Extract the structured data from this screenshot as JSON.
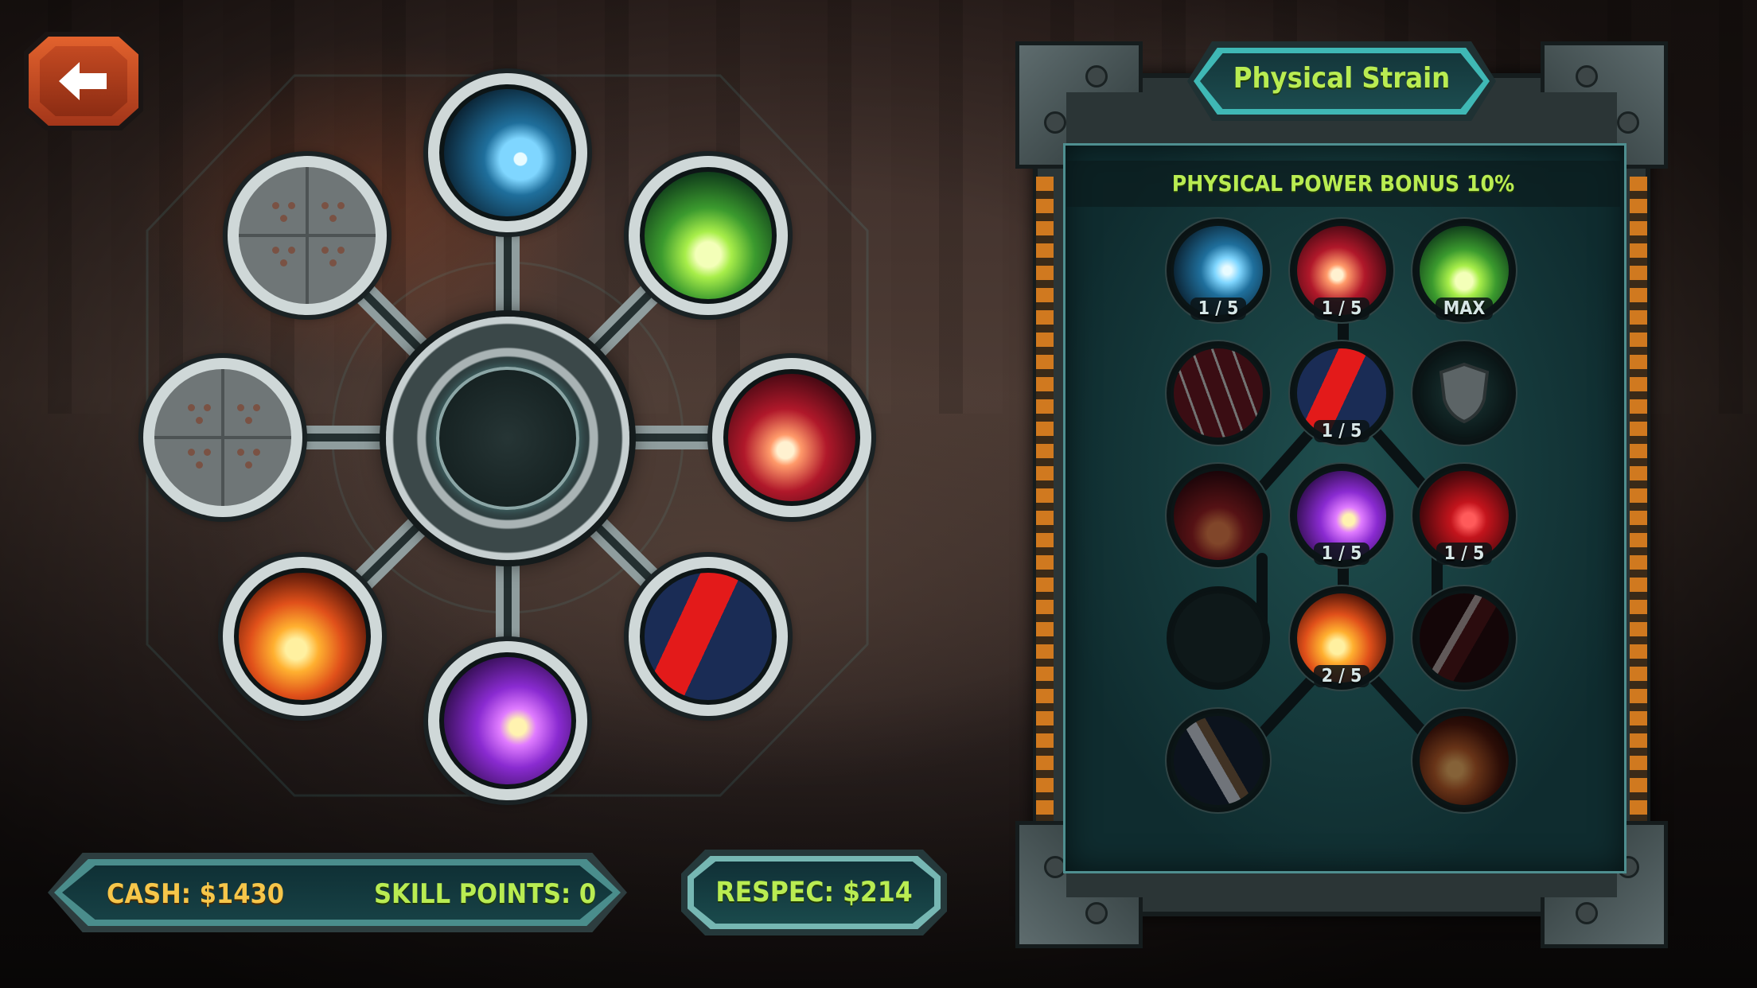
{
  "back_button": {
    "icon": "arrow-left-icon"
  },
  "status": {
    "cash": "CASH: $1430",
    "skill_points": "SKILL POINTS: 0",
    "respec": "RESPEC: $214"
  },
  "skill_tree": {
    "title": "Physical Strain",
    "bonus": "PHYSICAL POWER BONUS 10%",
    "rows": [
      [
        {
          "icon": "blue-slash-icon",
          "level": "1 / 5"
        },
        {
          "icon": "red-comet-icon",
          "level": "1 / 5"
        },
        {
          "icon": "green-poison-icon",
          "level": "MAX"
        }
      ],
      [
        {
          "icon": "red-claw-icon",
          "level": ""
        },
        {
          "icon": "crimson-strike-icon",
          "level": "1 / 5"
        },
        {
          "icon": "shield-icon",
          "level": ""
        }
      ],
      [
        {
          "icon": "flame-burst-icon",
          "level": ""
        },
        {
          "icon": "purple-fist-icon",
          "level": "1 / 5"
        },
        {
          "icon": "blood-drop-icon",
          "level": "1 / 5"
        }
      ],
      [
        {
          "icon": "empty-slot-icon",
          "level": ""
        },
        {
          "icon": "fire-drill-icon",
          "level": "2 / 5"
        },
        {
          "icon": "dark-blade-icon",
          "level": ""
        }
      ],
      [
        {
          "icon": "steel-blade-icon",
          "level": ""
        },
        {
          "icon": "",
          "level": ""
        },
        {
          "icon": "fire-kick-icon",
          "level": ""
        }
      ]
    ]
  },
  "wheel": {
    "nodes": [
      "blue-slash-icon",
      "green-poison-icon",
      "red-comet-icon",
      "crimson-strike-icon",
      "purple-fist-icon",
      "fire-drill-icon",
      "locked-slot-icon",
      "locked-slot-icon"
    ]
  }
}
